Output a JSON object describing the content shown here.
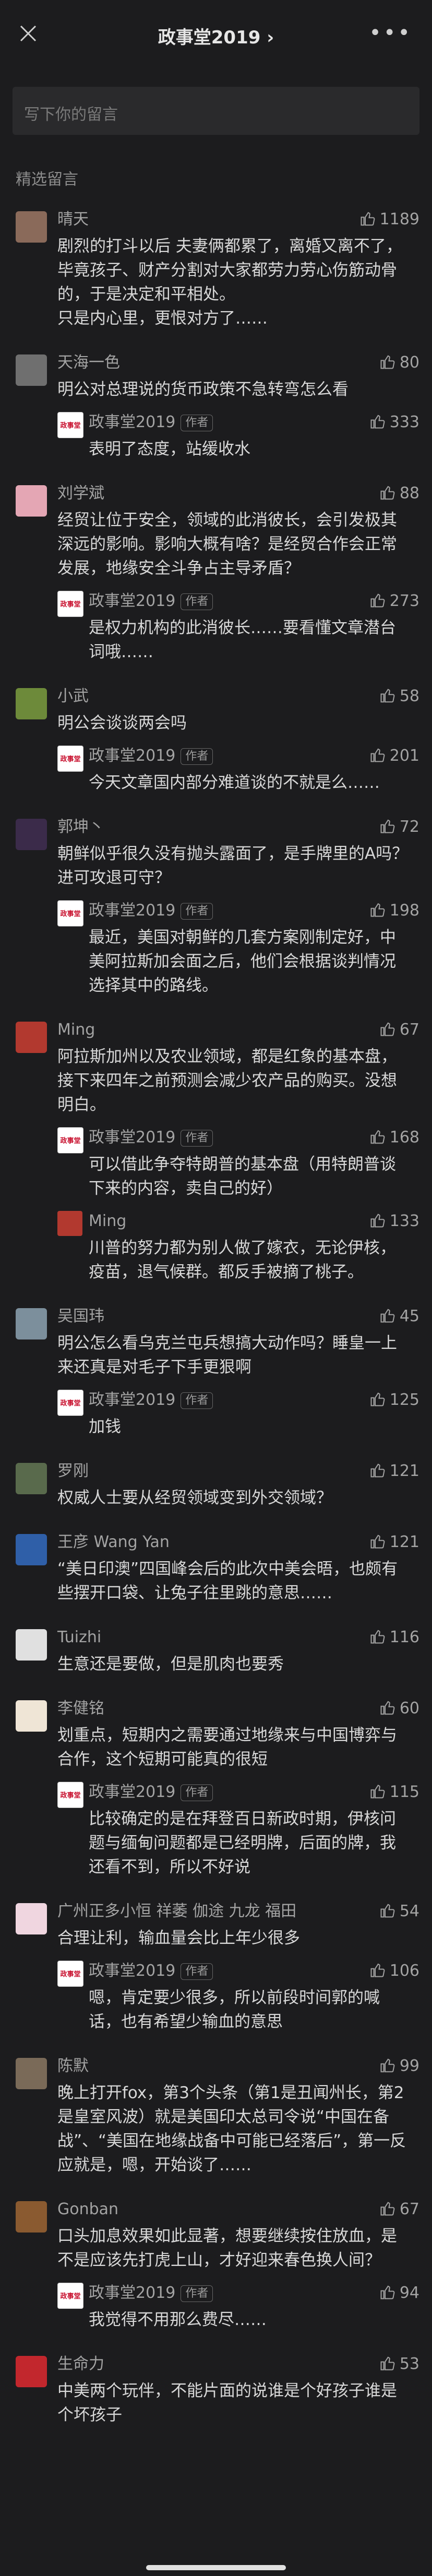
{
  "nav": {
    "title": "政事堂2019 ›",
    "more": "•••"
  },
  "input": {
    "placeholder": "写下你的留言"
  },
  "section_title": "精选留言",
  "author_tag": "作者",
  "comments": [
    {
      "name": "晴天",
      "likes": "1189",
      "avatar_color": "#8a6a5a",
      "text": "剧烈的打斗以后 夫妻俩都累了，离婚又离不了，毕竟孩子、财产分割对大家都劳力劳心伤筋动骨的，于是决定和平相处。\n只是内心里，更恨对方了……",
      "replies": []
    },
    {
      "name": "天海一色",
      "likes": "80",
      "avatar_color": "#6f6f6f",
      "text": "明公对总理说的货币政策不急转弯怎么看",
      "replies": [
        {
          "name": "政事堂2019",
          "likes": "333",
          "text": "表明了态度，站缓收水"
        }
      ]
    },
    {
      "name": "刘学斌",
      "likes": "88",
      "avatar_color": "#e4a6b4",
      "text": "经贸让位于安全，领域的此消彼长，会引发极其深远的影响。影响大概有啥？是经贸合作会正常发展，地缘安全斗争占主导矛盾？",
      "replies": [
        {
          "name": "政事堂2019",
          "likes": "273",
          "text": "是权力机构的此消彼长……要看懂文章潜台词哦……"
        }
      ]
    },
    {
      "name": "小武",
      "likes": "58",
      "avatar_color": "#6d8a3a",
      "text": "明公会谈谈两会吗",
      "replies": [
        {
          "name": "政事堂2019",
          "likes": "201",
          "text": "今天文章国内部分难道谈的不就是么……"
        }
      ]
    },
    {
      "name": "郭坤丶",
      "likes": "72",
      "avatar_color": "#3b2b4a",
      "text": "朝鲜似乎很久没有抛头露面了，是手牌里的A吗？进可攻退可守？",
      "replies": [
        {
          "name": "政事堂2019",
          "likes": "198",
          "text": "最近，美国对朝鲜的几套方案刚制定好，中美阿拉斯加会面之后，他们会根据谈判情况选择其中的路线。"
        }
      ]
    },
    {
      "name": "Ming",
      "likes": "67",
      "avatar_color": "#b2392f",
      "text": "阿拉斯加州以及农业领域，都是红象的基本盘，接下来四年之前预测会减少农产品的购买。没想明白。",
      "replies": [
        {
          "name": "政事堂2019",
          "likes": "168",
          "text": "可以借此争夺特朗普的基本盘（用特朗普谈下来的内容，卖自己的好）"
        },
        {
          "name": "Ming",
          "likes": "133",
          "text": "川普的努力都为别人做了嫁衣，无论伊核，疫苗，退气候群。都反手被摘了桃子。"
        }
      ]
    },
    {
      "name": "吴国玮",
      "likes": "45",
      "avatar_color": "#7c8f9c",
      "text": "明公怎么看乌克兰屯兵想搞大动作吗？睡皇一上来还真是对毛子下手更狠啊",
      "replies": [
        {
          "name": "政事堂2019",
          "likes": "125",
          "text": "加钱"
        }
      ]
    },
    {
      "name": "罗刚",
      "likes": "121",
      "avatar_color": "#596a4c",
      "text": "权威人士要从经贸领域变到外交领域？",
      "replies": []
    },
    {
      "name": "王彦 Wang Yan",
      "likes": "121",
      "avatar_color": "#2f5fa8",
      "text": "“美日印澳”四国峰会后的此次中美会晤，也颇有些摆开口袋、让兔子往里跳的意思……",
      "replies": []
    },
    {
      "name": "Tuizhi",
      "likes": "116",
      "avatar_color": "#e0e0e0",
      "text": "生意还是要做，但是肌肉也要秀",
      "replies": []
    },
    {
      "name": "李健铭",
      "likes": "60",
      "avatar_color": "#efe5d6",
      "text": "划重点，短期内之需要通过地缘来与中国博弈与合作，这个短期可能真的很短",
      "replies": [
        {
          "name": "政事堂2019",
          "likes": "115",
          "text": "比较确定的是在拜登百日新政时期，伊核问题与缅甸问题都是已经明牌，后面的牌，我还看不到，所以不好说"
        }
      ]
    },
    {
      "name": "广州正多小恒 祥萎 伽途 九龙 福田",
      "likes": "54",
      "avatar_color": "#f0d6e0",
      "text": "合理让利，输血量会比上年少很多",
      "replies": [
        {
          "name": "政事堂2019",
          "likes": "106",
          "text": "嗯，肯定要少很多，所以前段时间郭的喊话，也有希望少输血的意思"
        }
      ]
    },
    {
      "name": "陈默",
      "likes": "99",
      "avatar_color": "#7a6a58",
      "text": "晚上打开fox，第3个头条（第1是丑闻州长，第2是皇室风波）就是美国印太总司令说“中国在备战”、“美国在地缘战备中可能已经落后”，第一反应就是，嗯，开始谈了……",
      "replies": []
    },
    {
      "name": "Gonban",
      "likes": "67",
      "avatar_color": "#8a5a30",
      "text": "口头加息效果如此显著，想要继续按住放血，是不是应该先打虎上山，才好迎来春色换人间？",
      "replies": [
        {
          "name": "政事堂2019",
          "likes": "94",
          "text": "我觉得不用那么费尽……"
        }
      ]
    },
    {
      "name": "生命力",
      "likes": "53",
      "avatar_color": "#c2272d",
      "text": "中美两个玩伴，不能片面的说谁是个好孩子谁是个坏孩子",
      "replies": []
    }
  ]
}
